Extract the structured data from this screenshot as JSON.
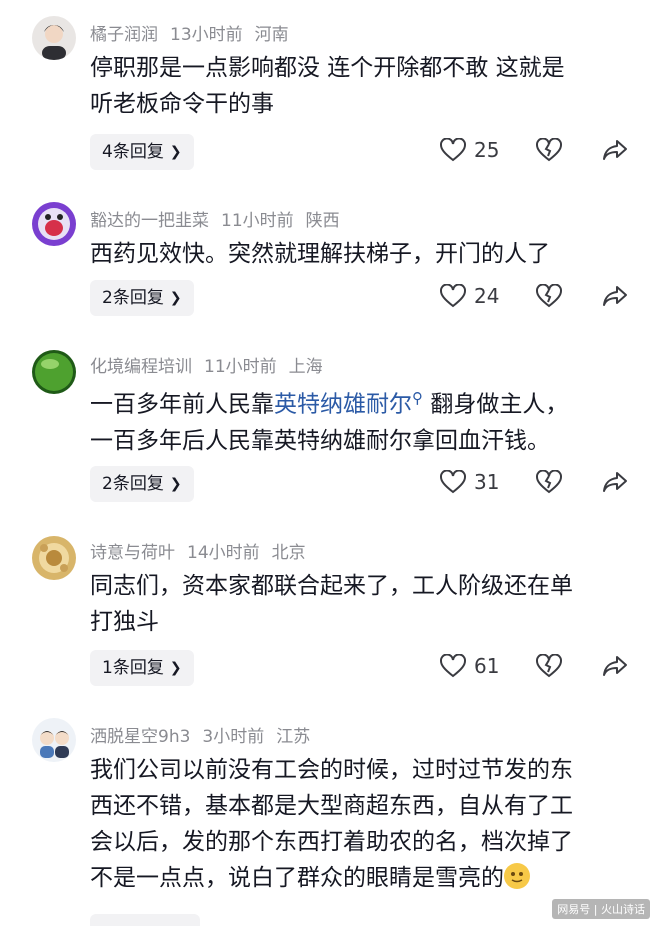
{
  "comments": [
    {
      "username": "橘子润润",
      "time": "13小时前",
      "location": "河南",
      "text_lines": [
        "停职那是一点影响都没 连个开除都不敢 这就是",
        "听老板命令干的事"
      ],
      "replies_label": "4条回复",
      "likes": "25"
    },
    {
      "username": "豁达的一把韭菜",
      "time": "11小时前",
      "location": "陕西",
      "text_lines": [
        "西药见效快。突然就理解扶梯子，开门的人了"
      ],
      "replies_label": "2条回复",
      "likes": "24"
    },
    {
      "username": "化境编程培训",
      "time": "11小时前",
      "location": "上海",
      "text_line1_prefix": "一百多年前人民靠",
      "text_line1_keyword": "英特纳雄耐尔",
      "text_line1_suffix": "翻身做主人，",
      "text_line2": "一百多年后人民靠英特纳雄耐尔拿回血汗钱。",
      "replies_label": "2条回复",
      "likes": "31"
    },
    {
      "username": "诗意与荷叶",
      "time": "14小时前",
      "location": "北京",
      "text_lines": [
        "同志们，资本家都联合起来了，工人阶级还在单",
        "打独斗"
      ],
      "replies_label": "1条回复",
      "likes": "61"
    },
    {
      "username": "洒脱星空9h3",
      "time": "3小时前",
      "location": "江苏",
      "text_lines": [
        "我们公司以前没有工会的时候，过时过节发的东",
        "西还不错，基本都是大型商超东西，自从有了工",
        "会以后，发的那个东西打着助农的名，档次掉了",
        "不是一点点，说白了群众的眼睛是雪亮的"
      ]
    }
  ],
  "watermark": "网易号 | 火山诗话",
  "colors": {
    "meta": "#8a8b91",
    "keyword": "#2b5aa6",
    "reply_bg": "#f2f2f4"
  }
}
